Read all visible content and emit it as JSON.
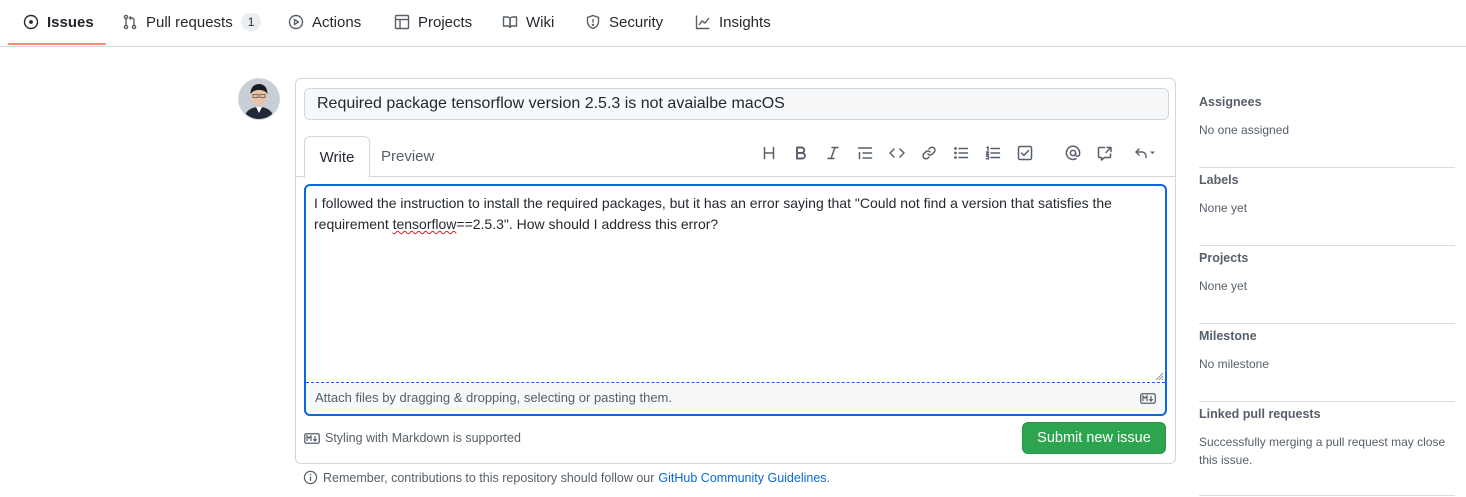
{
  "tabs": [
    {
      "label": "Issues",
      "icon": "issue-opened-icon",
      "active": true
    },
    {
      "label": "Pull requests",
      "icon": "git-pull-request-icon",
      "count": "1"
    },
    {
      "label": "Actions",
      "icon": "play-icon"
    },
    {
      "label": "Projects",
      "icon": "table-icon"
    },
    {
      "label": "Wiki",
      "icon": "book-icon"
    },
    {
      "label": "Security",
      "icon": "shield-icon"
    },
    {
      "label": "Insights",
      "icon": "graph-icon"
    }
  ],
  "issue": {
    "title_value": "Required package tensorflow version 2.5.3 is not avaialbe macOS",
    "editor_tabs": {
      "write": "Write",
      "preview": "Preview"
    },
    "body_line1": "I followed the instruction to install the required packages, but it has an error saying that \"Could not find a version that satisfies the",
    "body_line2_prefix": "requirement ",
    "body_line2_misspelled": "tensorflow",
    "body_line2_suffix": "==2.5.3\". How should I address this error?",
    "attach_hint": "Attach files by dragging & dropping, selecting or pasting them.",
    "markdown_note": "Styling with Markdown is supported",
    "submit_label": "Submit new issue"
  },
  "toolbar": [
    "heading-icon",
    "bold-icon",
    "italic-icon",
    "quote-icon",
    "code-icon",
    "link-icon",
    "unordered-list-icon",
    "ordered-list-icon",
    "tasklist-icon",
    "mention-icon",
    "cross-reference-icon",
    "reply-icon"
  ],
  "footer": {
    "text": "Remember, contributions to this repository should follow our",
    "link": "GitHub Community Guidelines",
    "period": "."
  },
  "sidebar": [
    {
      "title": "Assignees",
      "value": "No one assigned"
    },
    {
      "title": "Labels",
      "value": "None yet"
    },
    {
      "title": "Projects",
      "value": "None yet"
    },
    {
      "title": "Milestone",
      "value": "No milestone"
    },
    {
      "title": "Linked pull requests",
      "value": "Successfully merging a pull request may close this issue."
    }
  ],
  "colors": {
    "accent": "#0969da",
    "submit": "#2da44e",
    "tab_underline": "#fd8c73"
  }
}
